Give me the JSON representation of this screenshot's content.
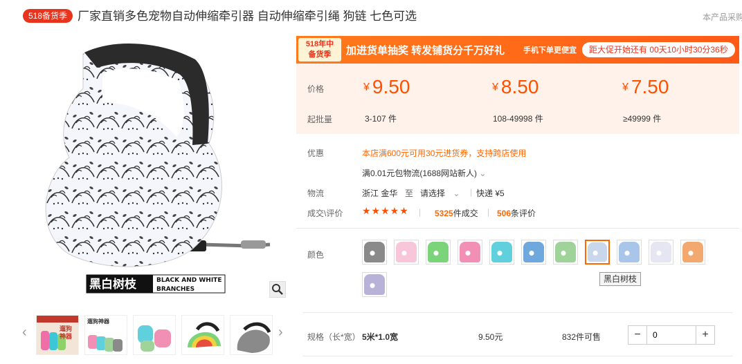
{
  "header": {
    "promo_badge": "518备货季",
    "title": "厂家直销多色宠物自动伸缩牵引器 自动伸缩牵引绳 狗链 七色可选",
    "right_text": "本产品采购"
  },
  "gallery": {
    "caption_cn": "黑白树枝",
    "caption_en_1": "BLACK AND WHITE",
    "caption_en_2": "BRANCHES",
    "thumb_1_text_a": "遛狗",
    "thumb_1_text_b": "神器",
    "thumb_2_text": "遛狗神器"
  },
  "banner": {
    "tag_line1": "518年中",
    "tag_line2": "备货季",
    "main": "加进货单抽奖 转发铺货分千万好礼",
    "sub": "手机下单更便宜",
    "countdown": "距大促开始还有 00天10小时30分36秒"
  },
  "price": {
    "price_label": "价格",
    "moq_label": "起批量",
    "currency": "¥",
    "tiers": [
      {
        "price": "9.50",
        "range": "3-107 件"
      },
      {
        "price": "8.50",
        "range": "108-49998 件"
      },
      {
        "price": "7.50",
        "range": "≥49999 件"
      }
    ]
  },
  "info": {
    "discount_label": "优惠",
    "discount_text": "本店满600元可用30元进货券，支持跨店使用",
    "shipping_promo": "满0.01元包物流(1688网站新人)",
    "logistics_label": "物流",
    "origin": "浙江 金华",
    "to": "至",
    "dest": "请选择",
    "express": "快递 ¥5",
    "deals_label": "成交\\评价",
    "stars": "★★★★★",
    "deals_count": "5325",
    "deals_suffix": "件成交",
    "reviews_count": "506",
    "reviews_suffix": "条评价"
  },
  "colors": {
    "label": "颜色",
    "tooltip": "黑白树枝",
    "swatches": [
      {
        "name": "grey",
        "color": "#8a8a8a"
      },
      {
        "name": "pink-dots",
        "color": "#f7c6d9"
      },
      {
        "name": "rainbow-stripes",
        "color": "#7bd37a"
      },
      {
        "name": "pink-polka",
        "color": "#f28fb4"
      },
      {
        "name": "cyan-polka",
        "color": "#5fd0dc"
      },
      {
        "name": "blue-pattern",
        "color": "#6fa8dc"
      },
      {
        "name": "green-floral",
        "color": "#9fd39a"
      },
      {
        "name": "black-white-branches",
        "color": "#c9d7ea",
        "selected": true
      },
      {
        "name": "blue-floral",
        "color": "#a9c6ea"
      },
      {
        "name": "white-floral",
        "color": "#e6e6f2"
      },
      {
        "name": "colorful-floral",
        "color": "#f2a86f"
      },
      {
        "name": "purple-floral",
        "color": "#b8b2d8"
      }
    ]
  },
  "spec": {
    "label": "规格（长*宽）",
    "value": "5米*1.0宽",
    "price": "9.50元",
    "stock": "832件可售",
    "qty": "0",
    "minus": "−",
    "plus": "+"
  },
  "zoom_icon": "magnifier-icon"
}
